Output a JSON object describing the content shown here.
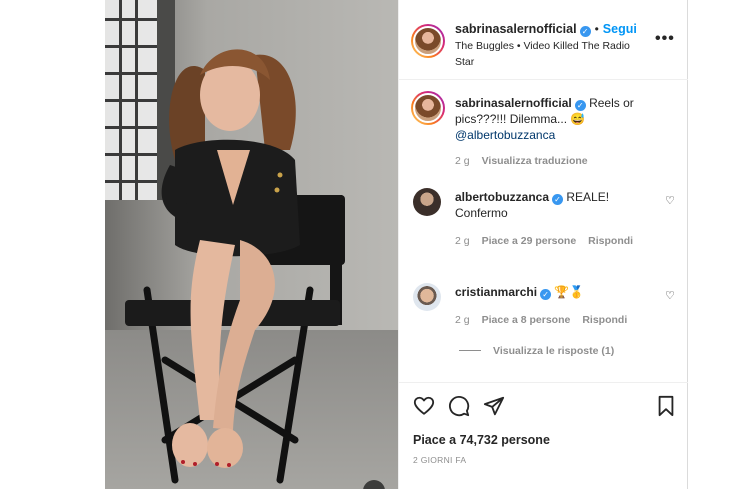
{
  "header": {
    "username": "sabrinasalernofficial",
    "follow_label": "Segui",
    "audio": "The Buggles • Video Killed The Radio Star"
  },
  "caption": {
    "username": "sabrinasalernofficial",
    "text": "Reels or pics???!!! Dilemma... 😅",
    "mention": "@albertobuzzanca",
    "age": "2 g",
    "translate_label": "Visualizza traduzione"
  },
  "comments": [
    {
      "username": "albertobuzzanca",
      "text": "REALE! Confermo",
      "age": "2 g",
      "likes_label": "Piace a 29 persone",
      "reply_label": "Rispondi"
    },
    {
      "username": "cristianmarchi",
      "text": "🏆🥇",
      "age": "2 g",
      "likes_label": "Piace a 8 persone",
      "reply_label": "Rispondi"
    }
  ],
  "replies_label": "Visualizza le risposte (1)",
  "footer": {
    "likes_text": "Piace a 74,732 persone",
    "date_text": "2 GIORNI FA"
  },
  "icons": [
    "heart-icon",
    "comment-icon",
    "share-icon",
    "bookmark-icon",
    "more-icon",
    "verified-icon"
  ],
  "colors": {
    "link": "#0095f6",
    "verified": "#3897f0",
    "text": "#262626",
    "muted": "#8e8e8e"
  }
}
